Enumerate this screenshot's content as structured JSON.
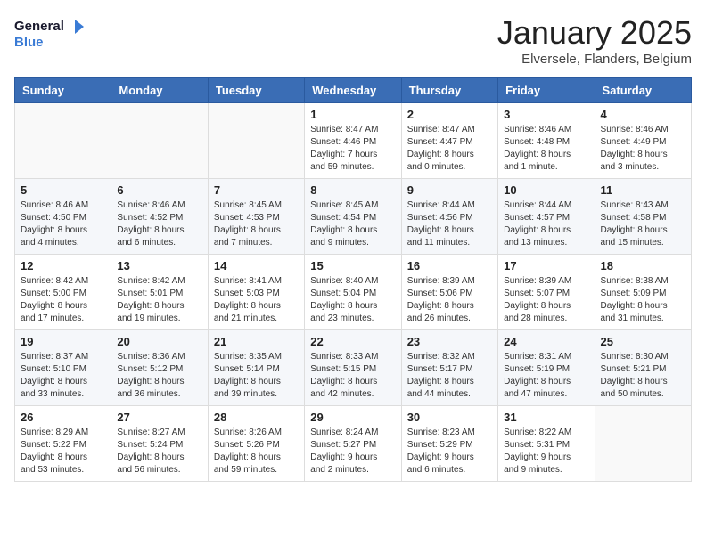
{
  "logo": {
    "line1": "General",
    "line2": "Blue"
  },
  "title": "January 2025",
  "location": "Elversele, Flanders, Belgium",
  "days_of_week": [
    "Sunday",
    "Monday",
    "Tuesday",
    "Wednesday",
    "Thursday",
    "Friday",
    "Saturday"
  ],
  "weeks": [
    [
      {
        "day": "",
        "info": ""
      },
      {
        "day": "",
        "info": ""
      },
      {
        "day": "",
        "info": ""
      },
      {
        "day": "1",
        "info": "Sunrise: 8:47 AM\nSunset: 4:46 PM\nDaylight: 7 hours\nand 59 minutes."
      },
      {
        "day": "2",
        "info": "Sunrise: 8:47 AM\nSunset: 4:47 PM\nDaylight: 8 hours\nand 0 minutes."
      },
      {
        "day": "3",
        "info": "Sunrise: 8:46 AM\nSunset: 4:48 PM\nDaylight: 8 hours\nand 1 minute."
      },
      {
        "day": "4",
        "info": "Sunrise: 8:46 AM\nSunset: 4:49 PM\nDaylight: 8 hours\nand 3 minutes."
      }
    ],
    [
      {
        "day": "5",
        "info": "Sunrise: 8:46 AM\nSunset: 4:50 PM\nDaylight: 8 hours\nand 4 minutes."
      },
      {
        "day": "6",
        "info": "Sunrise: 8:46 AM\nSunset: 4:52 PM\nDaylight: 8 hours\nand 6 minutes."
      },
      {
        "day": "7",
        "info": "Sunrise: 8:45 AM\nSunset: 4:53 PM\nDaylight: 8 hours\nand 7 minutes."
      },
      {
        "day": "8",
        "info": "Sunrise: 8:45 AM\nSunset: 4:54 PM\nDaylight: 8 hours\nand 9 minutes."
      },
      {
        "day": "9",
        "info": "Sunrise: 8:44 AM\nSunset: 4:56 PM\nDaylight: 8 hours\nand 11 minutes."
      },
      {
        "day": "10",
        "info": "Sunrise: 8:44 AM\nSunset: 4:57 PM\nDaylight: 8 hours\nand 13 minutes."
      },
      {
        "day": "11",
        "info": "Sunrise: 8:43 AM\nSunset: 4:58 PM\nDaylight: 8 hours\nand 15 minutes."
      }
    ],
    [
      {
        "day": "12",
        "info": "Sunrise: 8:42 AM\nSunset: 5:00 PM\nDaylight: 8 hours\nand 17 minutes."
      },
      {
        "day": "13",
        "info": "Sunrise: 8:42 AM\nSunset: 5:01 PM\nDaylight: 8 hours\nand 19 minutes."
      },
      {
        "day": "14",
        "info": "Sunrise: 8:41 AM\nSunset: 5:03 PM\nDaylight: 8 hours\nand 21 minutes."
      },
      {
        "day": "15",
        "info": "Sunrise: 8:40 AM\nSunset: 5:04 PM\nDaylight: 8 hours\nand 23 minutes."
      },
      {
        "day": "16",
        "info": "Sunrise: 8:39 AM\nSunset: 5:06 PM\nDaylight: 8 hours\nand 26 minutes."
      },
      {
        "day": "17",
        "info": "Sunrise: 8:39 AM\nSunset: 5:07 PM\nDaylight: 8 hours\nand 28 minutes."
      },
      {
        "day": "18",
        "info": "Sunrise: 8:38 AM\nSunset: 5:09 PM\nDaylight: 8 hours\nand 31 minutes."
      }
    ],
    [
      {
        "day": "19",
        "info": "Sunrise: 8:37 AM\nSunset: 5:10 PM\nDaylight: 8 hours\nand 33 minutes."
      },
      {
        "day": "20",
        "info": "Sunrise: 8:36 AM\nSunset: 5:12 PM\nDaylight: 8 hours\nand 36 minutes."
      },
      {
        "day": "21",
        "info": "Sunrise: 8:35 AM\nSunset: 5:14 PM\nDaylight: 8 hours\nand 39 minutes."
      },
      {
        "day": "22",
        "info": "Sunrise: 8:33 AM\nSunset: 5:15 PM\nDaylight: 8 hours\nand 42 minutes."
      },
      {
        "day": "23",
        "info": "Sunrise: 8:32 AM\nSunset: 5:17 PM\nDaylight: 8 hours\nand 44 minutes."
      },
      {
        "day": "24",
        "info": "Sunrise: 8:31 AM\nSunset: 5:19 PM\nDaylight: 8 hours\nand 47 minutes."
      },
      {
        "day": "25",
        "info": "Sunrise: 8:30 AM\nSunset: 5:21 PM\nDaylight: 8 hours\nand 50 minutes."
      }
    ],
    [
      {
        "day": "26",
        "info": "Sunrise: 8:29 AM\nSunset: 5:22 PM\nDaylight: 8 hours\nand 53 minutes."
      },
      {
        "day": "27",
        "info": "Sunrise: 8:27 AM\nSunset: 5:24 PM\nDaylight: 8 hours\nand 56 minutes."
      },
      {
        "day": "28",
        "info": "Sunrise: 8:26 AM\nSunset: 5:26 PM\nDaylight: 8 hours\nand 59 minutes."
      },
      {
        "day": "29",
        "info": "Sunrise: 8:24 AM\nSunset: 5:27 PM\nDaylight: 9 hours\nand 2 minutes."
      },
      {
        "day": "30",
        "info": "Sunrise: 8:23 AM\nSunset: 5:29 PM\nDaylight: 9 hours\nand 6 minutes."
      },
      {
        "day": "31",
        "info": "Sunrise: 8:22 AM\nSunset: 5:31 PM\nDaylight: 9 hours\nand 9 minutes."
      },
      {
        "day": "",
        "info": ""
      }
    ]
  ]
}
